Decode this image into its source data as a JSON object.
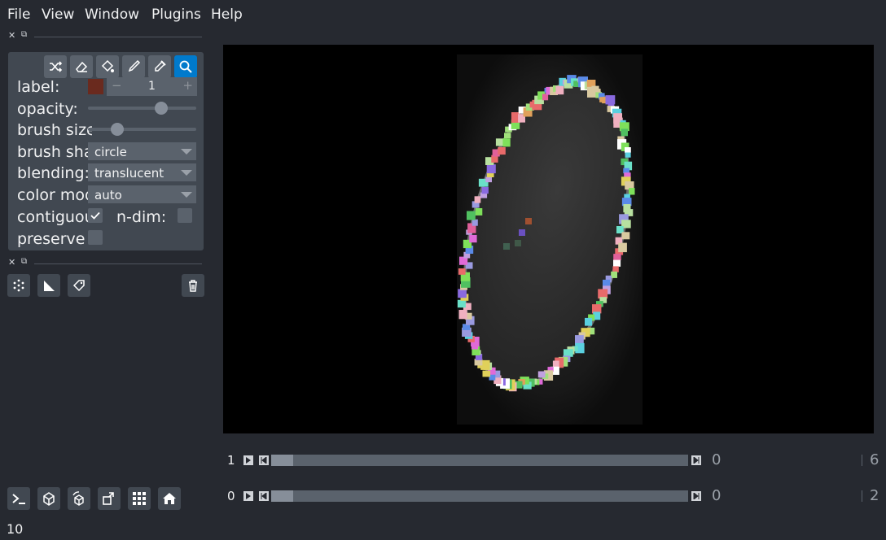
{
  "menu": [
    "File",
    "View",
    "Window",
    "Plugins",
    "Help"
  ],
  "label_controls": {
    "label_label": "label:",
    "label_value": "1",
    "minus": "−",
    "plus": "+",
    "label_color": "#6a2a1e",
    "opacity_label": "opacity:",
    "opacity_value": 0.68,
    "brush_size_label": "brush size:",
    "brush_size_fraction": 0.27,
    "brush_shape_label": "brush shape:",
    "brush_shape_value": "circle",
    "blending_label": "blending:",
    "blending_value": "translucent",
    "color_mode_label": "color mode:",
    "color_mode_value": "auto",
    "contiguous_label": "contiguous:",
    "contiguous_checked": true,
    "ndim_label": "n-dim:",
    "ndim_checked": false,
    "preserve_label": "preserve labels:",
    "preserve_checked": false
  },
  "tools": [
    "shuffle-icon",
    "eraser-icon",
    "fill-bucket-icon",
    "paint-brush-icon",
    "color-picker-icon",
    "zoom-icon"
  ],
  "layer_buttons": [
    "new-points-icon",
    "new-shapes-icon",
    "new-labels-icon",
    "delete-layer-icon"
  ],
  "dims": [
    {
      "label": "1",
      "value": "0",
      "max": "6",
      "fraction": 0.0
    },
    {
      "label": "0",
      "value": "0",
      "max": "2",
      "fraction": 0.0
    }
  ],
  "bottom_buttons": [
    "console-icon",
    "ndisplay-icon",
    "roll-dims-icon",
    "transpose-icon",
    "grid-icon",
    "home-icon"
  ],
  "status": "10",
  "colors": {
    "background": "#262930",
    "panel": "#414851",
    "accent": "#007acc"
  }
}
